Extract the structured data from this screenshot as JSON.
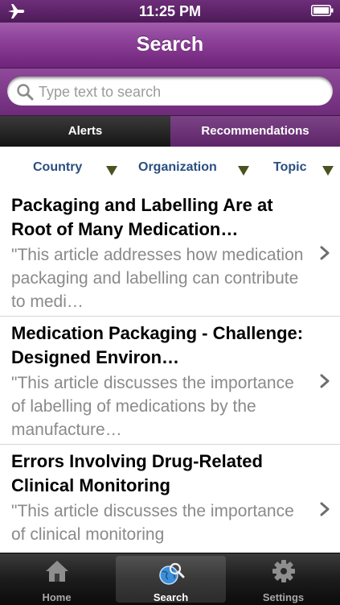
{
  "status_bar": {
    "time": "11:25 PM"
  },
  "nav": {
    "title": "Search"
  },
  "search": {
    "placeholder": "Type text to search",
    "value": ""
  },
  "segments": [
    {
      "label": "Alerts",
      "selected": true
    },
    {
      "label": "Recommendations",
      "selected": false
    }
  ],
  "filters": [
    {
      "label": "Country"
    },
    {
      "label": "Organization"
    },
    {
      "label": "Topic"
    }
  ],
  "results": [
    {
      "title": "Packaging and Labelling Are at Root of Many Medication…",
      "description": "\"This article addresses how medication packaging and labelling can contribute to medi…"
    },
    {
      "title": "Medication Packaging - Challenge: Designed Environ…",
      "description": "\"This article discusses the importance of labelling of medications by the manufacture…"
    },
    {
      "title": "Errors Involving Drug-Related Clinical Monitoring",
      "description": "\"This article discusses the importance of clinical monitoring"
    }
  ],
  "tabs": [
    {
      "label": "Home",
      "icon": "home-icon",
      "selected": false
    },
    {
      "label": "Search",
      "icon": "globe-search-icon",
      "selected": true
    },
    {
      "label": "Settings",
      "icon": "gear-icon",
      "selected": false
    }
  ],
  "colors": {
    "nav_purple": "#8a3e96",
    "link_blue": "#2a4e82",
    "triangle": "#4a5320"
  }
}
